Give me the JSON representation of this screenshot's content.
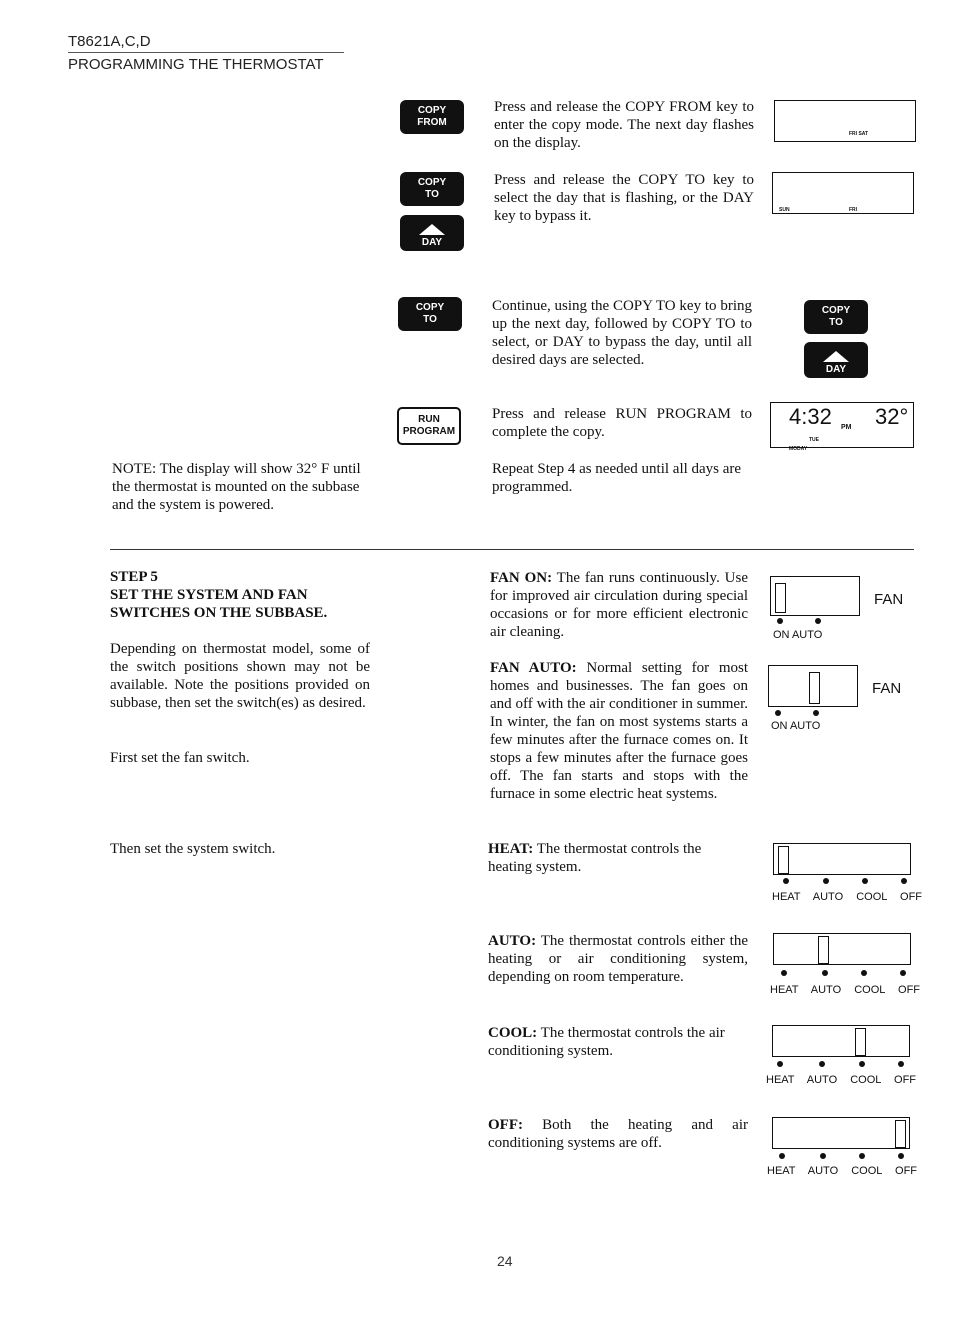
{
  "header": {
    "model": "T8621A,C,D",
    "section": "PROGRAMMING THE THERMOSTAT"
  },
  "keys": {
    "copy": "COPY",
    "from": "FROM",
    "to": "TO",
    "day": "DAY",
    "run": "RUN",
    "program": "PROGRAM"
  },
  "steps": [
    "Press and release the COPY FROM key to enter the copy mode. The next day flashes on the display.",
    "Press and release the COPY TO key to select the day that is flashing, or the DAY key to bypass it.",
    "Continue, using the COPY TO key to bring up the next day, followed by COPY TO to select, or DAY to bypass the day, until all desired days are selected.",
    "Press and release RUN PROGRAM to complete the copy.",
    "Repeat Step 4 as needed until all days are programmed."
  ],
  "displays": {
    "d1": "FRI SAT",
    "d2a": "SUN",
    "d2b": "FRI",
    "time": "4:32",
    "ampm": "PM",
    "temp": "32°",
    "day": "TUE",
    "bottom": "MODAY"
  },
  "note": "NOTE: The display will show 32° F until the thermostat is mounted on the subbase and the system is powered.",
  "step5": {
    "title": "STEP 5",
    "subtitle": "SET THE SYSTEM AND FAN SWITCHES ON THE SUBBASE.",
    "p1": "Depending on thermostat model, some of the switch positions shown may not be available. Note the positions provided on subbase, then set the switch(es) as desired.",
    "p2": "First set the fan switch.",
    "p3": "Then set the system switch."
  },
  "fan": {
    "label": "FAN",
    "on": "ON",
    "auto": "AUTO",
    "items": [
      {
        "term": "FAN ON:",
        "desc": " The fan runs continuously. Use for improved air circulation during special occasions or for more efficient electronic air cleaning.",
        "position": "on"
      },
      {
        "term": "FAN AUTO:",
        "desc": " Normal setting for most homes and businesses. The fan goes on and off with the air conditioner in summer. In winter, the fan on most systems starts a few minutes after the furnace comes on. It stops a few minutes after the furnace goes off. The fan starts and stops with the furnace in some electric heat systems.",
        "position": "auto"
      }
    ]
  },
  "system": {
    "labels": [
      "HEAT",
      "AUTO",
      "COOL",
      "OFF"
    ],
    "items": [
      {
        "term": "HEAT:",
        "desc": " The thermostat controls the heating system.",
        "position": "heat"
      },
      {
        "term": "AUTO:",
        "desc": " The thermostat controls either the heating or air conditioning system, depending on room temperature.",
        "position": "auto"
      },
      {
        "term": "COOL:",
        "desc": " The thermostat controls the air conditioning system.",
        "position": "cool"
      },
      {
        "term": "OFF:",
        "desc": " Both the heating and air conditioning systems are off.",
        "position": "off"
      }
    ]
  },
  "page_number": "24"
}
